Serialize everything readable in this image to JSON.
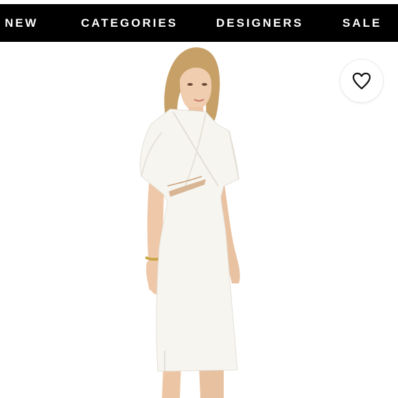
{
  "nav": {
    "items": [
      {
        "label": "NEW"
      },
      {
        "label": "CATEGORIES"
      },
      {
        "label": "DESIGNERS"
      },
      {
        "label": "SALE"
      }
    ]
  },
  "product_image": {
    "icon": "model-wearing-white-midi-dress"
  },
  "wishlist": {
    "icon": "heart-icon"
  },
  "colors": {
    "nav_background": "#000000",
    "nav_text": "#ffffff",
    "page_background": "#ffffff",
    "dress": "#f7f5f0"
  }
}
